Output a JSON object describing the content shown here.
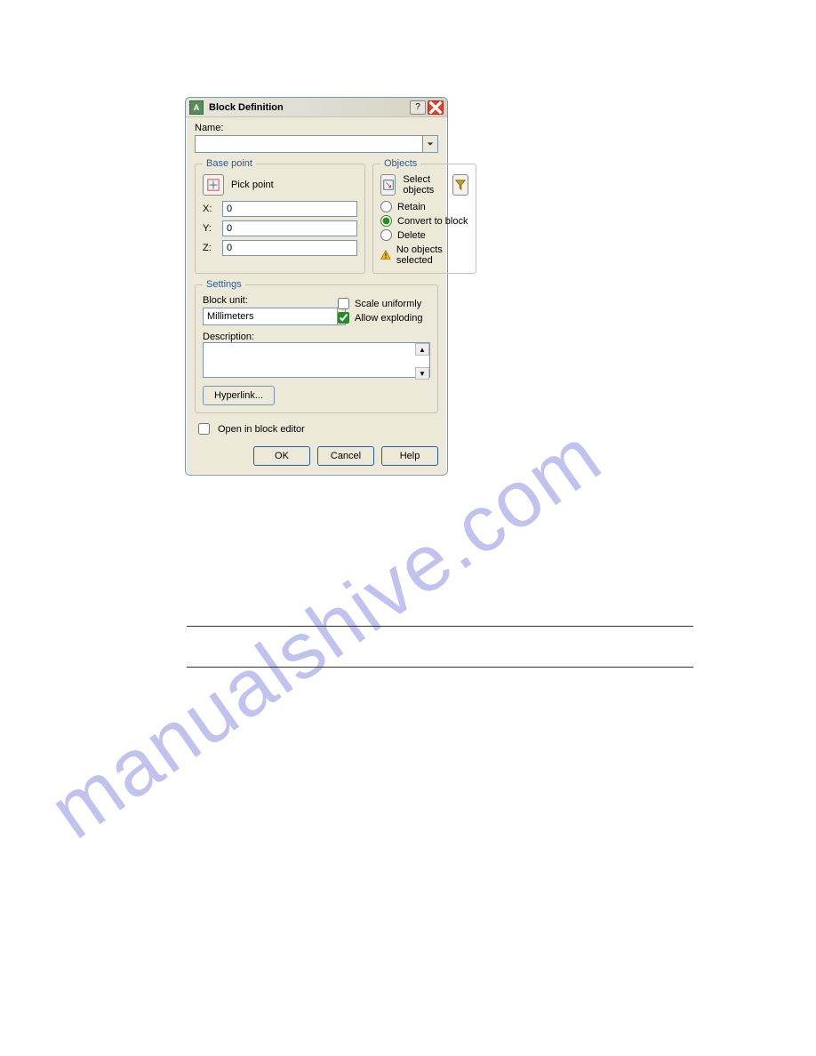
{
  "dialog": {
    "title": "Block Definition",
    "name_label": "Name:",
    "name_value": "",
    "base_point": {
      "legend": "Base point",
      "pick_label": "Pick point",
      "x_label": "X:",
      "y_label": "Y:",
      "z_label": "Z:",
      "x": "0",
      "y": "0",
      "z": "0"
    },
    "objects": {
      "legend": "Objects",
      "select_label": "Select objects",
      "retain": "Retain",
      "convert": "Convert to block",
      "delete": "Delete",
      "warning": "No objects selected"
    },
    "settings": {
      "legend": "Settings",
      "unit_label": "Block unit:",
      "unit_value": "Millimeters",
      "scale_label": "Scale uniformly",
      "explode_label": "Allow exploding",
      "description_label": "Description:",
      "description_value": "",
      "hyperlink_label": "Hyperlink..."
    },
    "open_editor_label": "Open in block editor",
    "buttons": {
      "ok": "OK",
      "cancel": "Cancel",
      "help": "Help"
    }
  },
  "watermark": "manualshive.com"
}
